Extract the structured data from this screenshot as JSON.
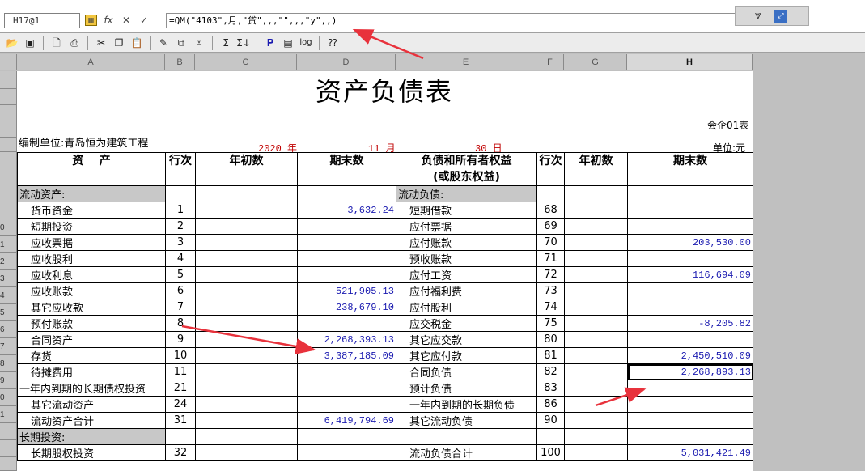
{
  "formula_bar": {
    "cell_ref": "H17@1",
    "formula": "=QM(\"4103\",月,\"贷\",,,\"\",,,\"y\",,)"
  },
  "toolbar": {
    "icons": [
      "open-icon",
      "save-icon",
      "preview-icon",
      "print-icon",
      "cut-icon",
      "copy-icon",
      "paste-icon",
      "format-painter-icon",
      "insert-icon",
      "filter-icon",
      "sum-icon",
      "sort-icon",
      "p-icon",
      "page-icon",
      "log-icon",
      "help-icon"
    ]
  },
  "columns": [
    "A",
    "B",
    "C",
    "D",
    "E",
    "F",
    "G",
    "H"
  ],
  "row_numbers": [
    "",
    "",
    "",
    "",
    "",
    "",
    "",
    "",
    "",
    "0",
    "1",
    "2",
    "3",
    "4",
    "5",
    "6",
    "7",
    "8",
    "9",
    "0",
    "1",
    ""
  ],
  "report": {
    "title": "资产负债表",
    "form_no": "会企01表",
    "company_label": "编制单位:青岛恒为建筑工程",
    "year": "2020 年",
    "month": "11 月",
    "day": "30 日",
    "unit": "单位:元",
    "headers": {
      "asset": "资    产",
      "line": "行次",
      "begin": "年初数",
      "end": "期末数",
      "liab": "负债和所有者权益",
      "liab2": "(或股东权益)",
      "line2": "行次",
      "begin2": "年初数",
      "end2": "期末数"
    },
    "rows": [
      {
        "a": "流动资产:",
        "b": "",
        "c": "",
        "d": "",
        "e": "流动负债:",
        "f": "",
        "g": "",
        "h": "",
        "sec_a": true,
        "sec_e": true
      },
      {
        "a": "货币资金",
        "b": "1",
        "c": "",
        "d": "3,632.24",
        "e": "短期借款",
        "f": "68",
        "g": "",
        "h": ""
      },
      {
        "a": "短期投资",
        "b": "2",
        "c": "",
        "d": "",
        "e": "应付票据",
        "f": "69",
        "g": "",
        "h": ""
      },
      {
        "a": "应收票据",
        "b": "3",
        "c": "",
        "d": "",
        "e": "应付账款",
        "f": "70",
        "g": "",
        "h": "203,530.00"
      },
      {
        "a": "应收股利",
        "b": "4",
        "c": "",
        "d": "",
        "e": "预收账款",
        "f": "71",
        "g": "",
        "h": ""
      },
      {
        "a": "应收利息",
        "b": "5",
        "c": "",
        "d": "",
        "e": "应付工资",
        "f": "72",
        "g": "",
        "h": "116,694.09"
      },
      {
        "a": "应收账款",
        "b": "6",
        "c": "",
        "d": "521,905.13",
        "e": "应付福利费",
        "f": "73",
        "g": "",
        "h": ""
      },
      {
        "a": "其它应收款",
        "b": "7",
        "c": "",
        "d": "238,679.10",
        "e": "应付股利",
        "f": "74",
        "g": "",
        "h": ""
      },
      {
        "a": "预付账款",
        "b": "8",
        "c": "",
        "d": "",
        "e": "应交税金",
        "f": "75",
        "g": "",
        "h": "-8,205.82"
      },
      {
        "a": "合同资产",
        "b": "9",
        "c": "",
        "d": "2,268,393.13",
        "e": "其它应交款",
        "f": "80",
        "g": "",
        "h": ""
      },
      {
        "a": "存货",
        "b": "10",
        "c": "",
        "d": "3,387,185.09",
        "e": "其它应付款",
        "f": "81",
        "g": "",
        "h": "2,450,510.09"
      },
      {
        "a": "待摊费用",
        "b": "11",
        "c": "",
        "d": "",
        "e": "合同负债",
        "f": "82",
        "g": "",
        "h": "2,268,893.13",
        "sel": true
      },
      {
        "a": "一年内到期的长期债权投资",
        "b": "21",
        "c": "",
        "d": "",
        "e": "预计负债",
        "f": "83",
        "g": "",
        "h": "",
        "noind": true
      },
      {
        "a": "其它流动资产",
        "b": "24",
        "c": "",
        "d": "",
        "e": "一年内到期的长期负债",
        "f": "86",
        "g": "",
        "h": ""
      },
      {
        "a": "流动资产合计",
        "b": "31",
        "c": "",
        "d": "6,419,794.69",
        "e": "其它流动负债",
        "f": "90",
        "g": "",
        "h": ""
      },
      {
        "a": "长期投资:",
        "b": "",
        "c": "",
        "d": "",
        "e": "",
        "f": "",
        "g": "",
        "h": "",
        "sec_a": true
      },
      {
        "a": "长期股权投资",
        "b": "32",
        "c": "",
        "d": "",
        "e": "流动负债合计",
        "f": "100",
        "g": "",
        "h": "5,031,421.49"
      }
    ]
  },
  "colors": {
    "accent_red": "#c00000",
    "number_blue": "#1a1ab0",
    "arrow_red": "#e8323c"
  }
}
